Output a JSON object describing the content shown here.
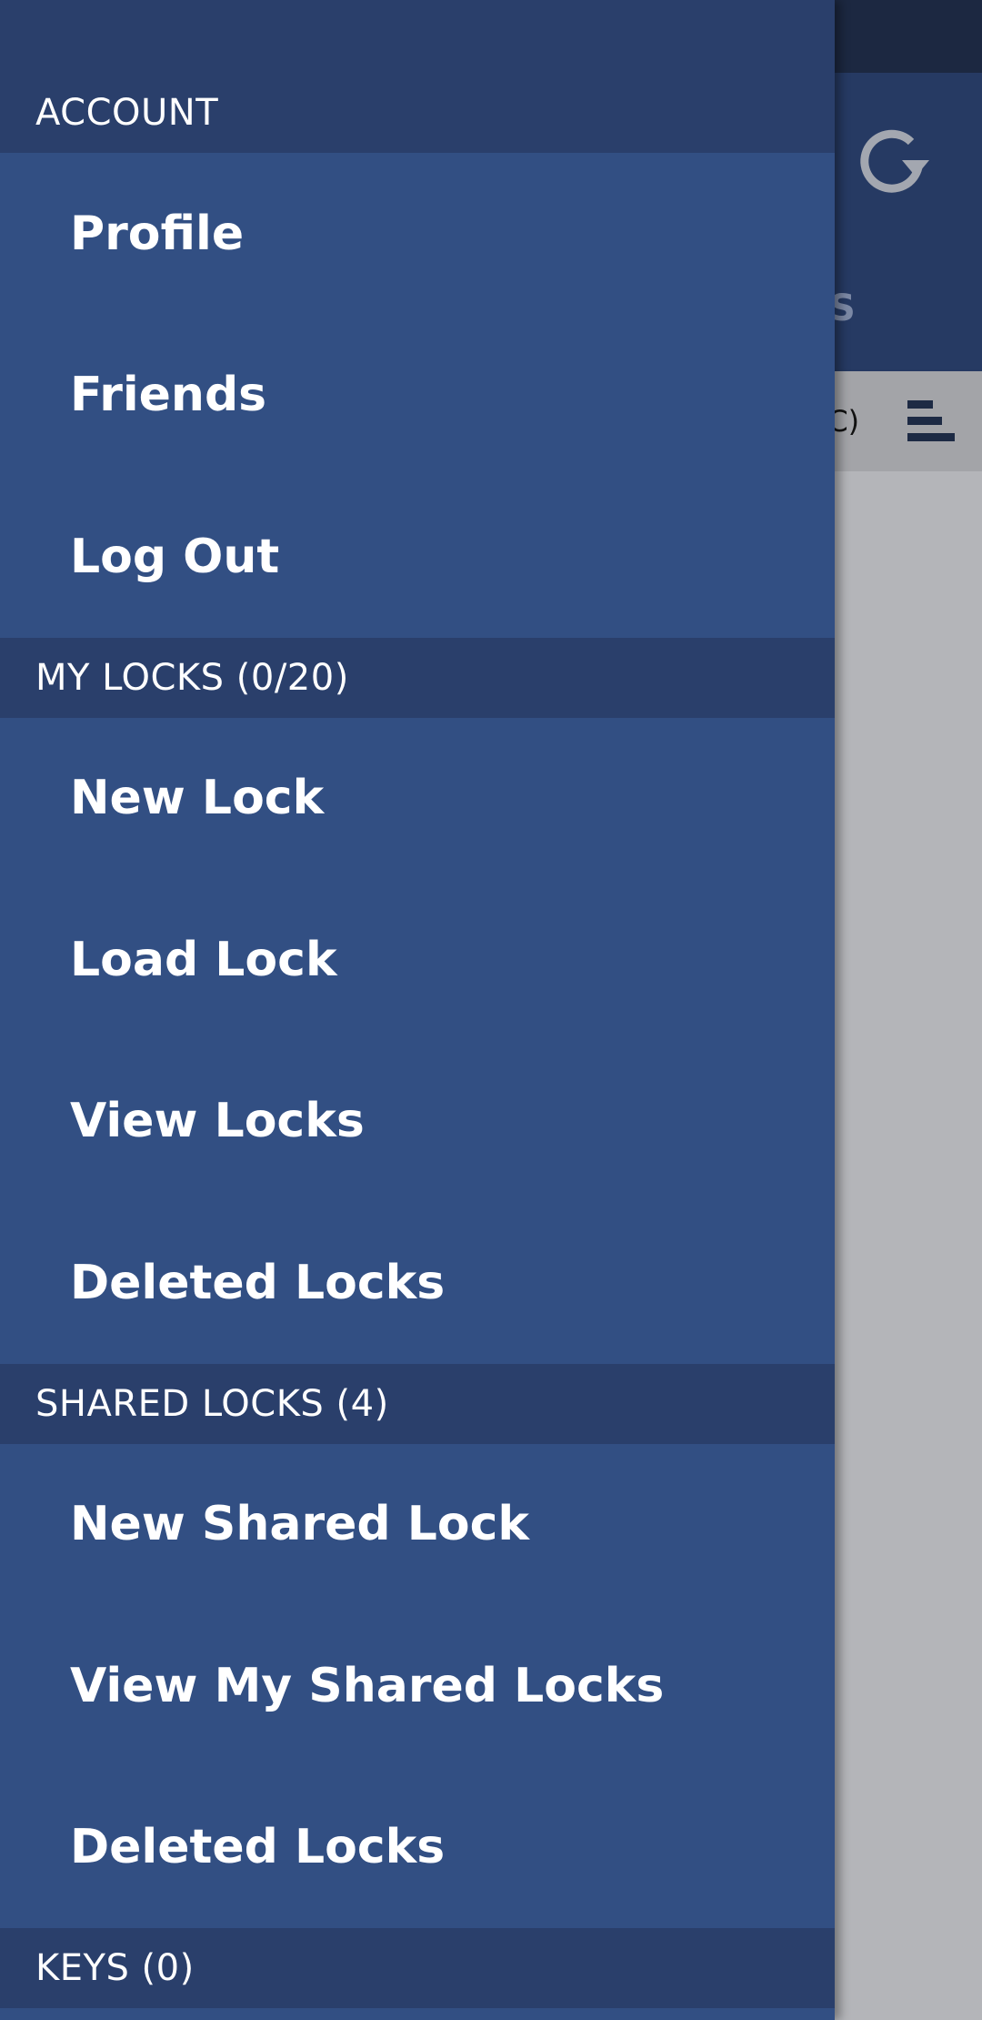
{
  "background_app": {
    "tab_partial_label": "KS",
    "sort_partial_label": "SC)",
    "refresh_icon": "refresh-icon",
    "sort_icon": "sort-icon"
  },
  "drawer": {
    "sections": {
      "account": {
        "header": "ACCOUNT",
        "items": [
          "Profile",
          "Friends",
          "Log Out"
        ]
      },
      "my_locks": {
        "header": "MY LOCKS (0/20)",
        "items": [
          "New Lock",
          "Load Lock",
          "View Locks",
          "Deleted Locks"
        ]
      },
      "shared_locks": {
        "header": "SHARED LOCKS (4)",
        "items": [
          "New Shared Lock",
          "View My Shared Locks",
          "Deleted Locks"
        ]
      },
      "keys": {
        "header": "KEYS (0)"
      }
    }
  },
  "colors": {
    "drawer_bg": "#324f83",
    "section_header_bg": "#2a3f6b",
    "toolbar_bg": "#263a63",
    "scrim_content": "#b4b5b9"
  }
}
